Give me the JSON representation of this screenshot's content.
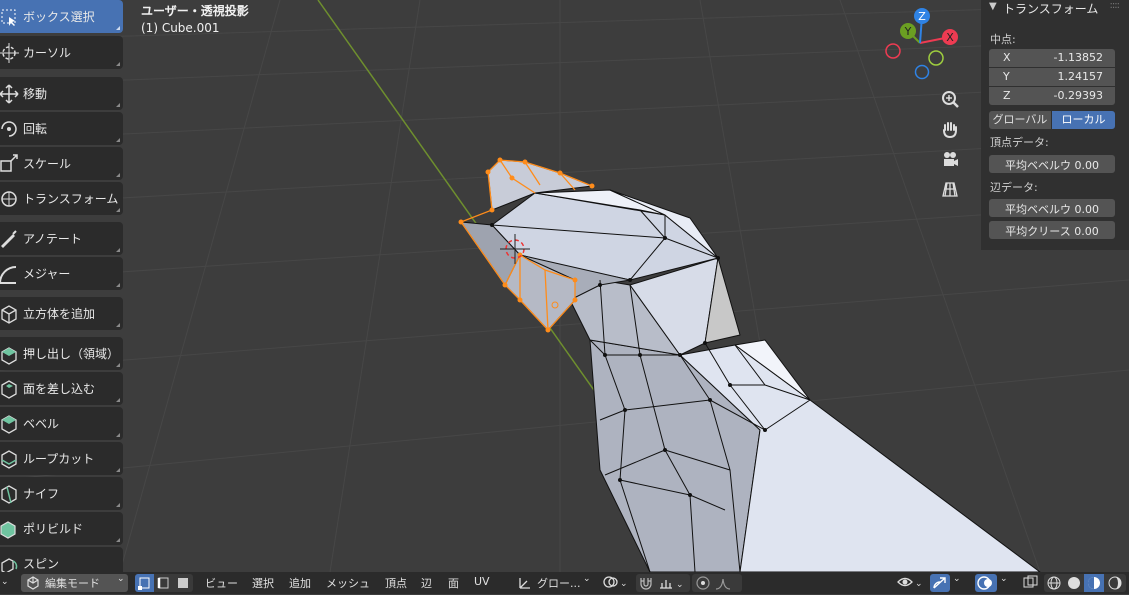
{
  "viewport": {
    "title": "ユーザー・透視投影",
    "object": "(1) Cube.001"
  },
  "toolbar": [
    {
      "label": "ボックス選択",
      "icon": "box-select-icon",
      "active": true
    },
    {
      "label": "カーソル",
      "icon": "cursor-icon"
    },
    {
      "label": "移動",
      "icon": "move-icon"
    },
    {
      "label": "回転",
      "icon": "rotate-icon"
    },
    {
      "label": "スケール",
      "icon": "scale-icon"
    },
    {
      "label": "トランスフォーム",
      "icon": "transform-icon"
    },
    {
      "label": "アノテート",
      "icon": "annotate-icon"
    },
    {
      "label": "メジャー",
      "icon": "measure-icon"
    },
    {
      "label": "立方体を追加",
      "icon": "add-cube-icon"
    },
    {
      "label": "押し出し（領域）",
      "icon": "extrude-region-icon"
    },
    {
      "label": "面を差し込む",
      "icon": "inset-faces-icon"
    },
    {
      "label": "ベベル",
      "icon": "bevel-icon"
    },
    {
      "label": "ループカット",
      "icon": "loop-cut-icon"
    },
    {
      "label": "ナイフ",
      "icon": "knife-icon"
    },
    {
      "label": "ポリビルド",
      "icon": "poly-build-icon"
    },
    {
      "label": "スピン",
      "icon": "spin-icon"
    }
  ],
  "gizmo": {
    "x": "X",
    "y": "Y",
    "z": "Z",
    "colors": {
      "x": "#ee3b52",
      "y": "#6b9f22",
      "z": "#2f83e5"
    }
  },
  "nav_icons": [
    "zoom-icon",
    "hand-pan-icon",
    "camera-icon",
    "grid-ortho-icon"
  ],
  "npanel": {
    "title": "トランスフォーム",
    "median_label": "中点:",
    "x_label": "X",
    "x_value": "-1.13852",
    "y_label": "Y",
    "y_value": "1.24157",
    "z_label": "Z",
    "z_value": "-0.29393",
    "global_label": "グローバル",
    "local_label": "ローカル",
    "vertex_data_label": "頂点データ:",
    "vertex_bevel": "平均ベベルウ  0.00",
    "edge_data_label": "辺データ:",
    "edge_bevel": "平均ベベルウ  0.00",
    "edge_crease": "平均クリース  0.00"
  },
  "bottombar": {
    "mode": "編集モード",
    "menus": [
      "ビュー",
      "選択",
      "追加",
      "メッシュ",
      "頂点",
      "辺",
      "面",
      "UV"
    ],
    "orientation": "グロー..."
  },
  "colors": {
    "accent": "#4772b3",
    "selected_edge": "#ff8c1a",
    "mesh_face": "#dfe4f0",
    "background": "#3d3d3d"
  }
}
